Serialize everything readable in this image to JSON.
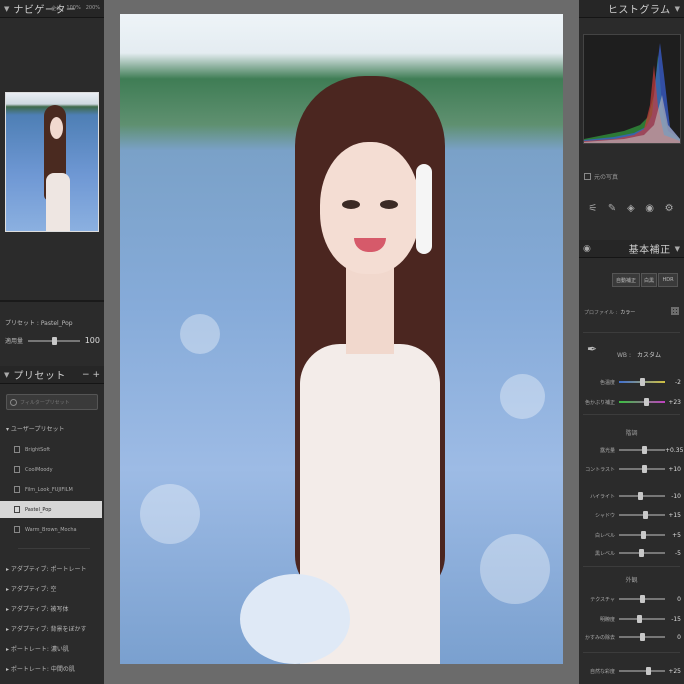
{
  "navigator": {
    "title": "ナビゲーター",
    "zoom": [
      "全体",
      "100%",
      "200%"
    ]
  },
  "preset_info": {
    "label": "プリセット : Pastel_Pop",
    "amount_label": "適用量",
    "amount_value": "100",
    "amount_fraction": 0.5
  },
  "presets": {
    "title": "プリセット",
    "controls": "− +",
    "search_placeholder": "フィルタープリセット",
    "group_label": "ユーザープリセット",
    "items": [
      "BrightSoft",
      "CoolMoody",
      "Film_Look_FUJIFILM",
      "Pastel_Pop",
      "Warm_Brown_Mocha"
    ],
    "selected": "Pastel_Pop",
    "folders": [
      "アダプティブ: ポートレート",
      "アダプティブ: 空",
      "アダプティブ: 被写体",
      "アダプティブ: 背景をぼかす",
      "ポートレート: 濃い肌",
      "ポートレート: 中間の肌"
    ]
  },
  "histogram": {
    "title": "ヒストグラム",
    "original_photo": "元の写真"
  },
  "basic": {
    "title": "基本補正",
    "buttons": [
      "自動補正",
      "白黒",
      "HDR"
    ],
    "profile_label": "プロファイル :",
    "profile_value": "カラー",
    "wb_label": "WB :",
    "wb_value": "カスタム",
    "tone_title": "階調",
    "presence_title": "外観",
    "sliders": [
      {
        "label": "色温度",
        "value": "-2",
        "pos": 0.49
      },
      {
        "label": "色かぶり補正",
        "value": "+23",
        "pos": 0.58
      },
      {
        "label": "露光量",
        "value": "+0.35",
        "pos": 0.54
      },
      {
        "label": "コントラスト",
        "value": "+10",
        "pos": 0.55
      },
      {
        "label": "ハイライト",
        "value": "-10",
        "pos": 0.45
      },
      {
        "label": "シャドウ",
        "value": "+15",
        "pos": 0.57
      },
      {
        "label": "白レベル",
        "value": "+5",
        "pos": 0.52
      },
      {
        "label": "黒レベル",
        "value": "-5",
        "pos": 0.48
      },
      {
        "label": "テクスチャ",
        "value": "0",
        "pos": 0.5
      },
      {
        "label": "明瞭度",
        "value": "-15",
        "pos": 0.43
      },
      {
        "label": "かすみの除去",
        "value": "0",
        "pos": 0.5
      },
      {
        "label": "自然な彩度",
        "value": "+25",
        "pos": 0.62
      }
    ]
  },
  "colors": {
    "accent_selected": "#d7d7d7",
    "panel_bg": "#2b2b2b",
    "center_bg": "#6b6b6b"
  }
}
